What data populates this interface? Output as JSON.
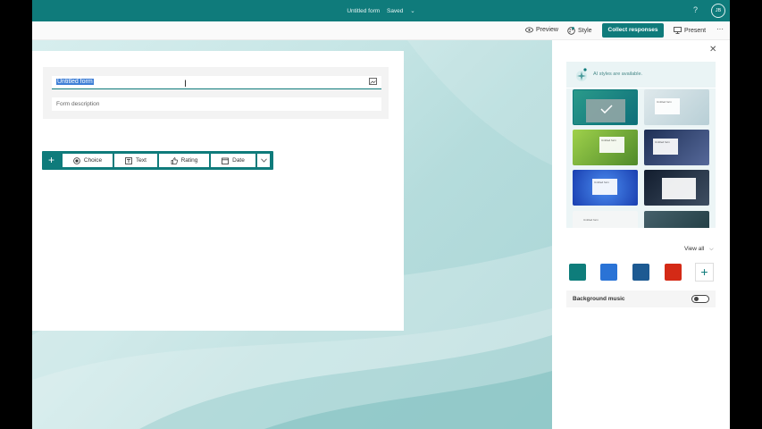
{
  "topbar": {
    "form_title": "Untitled form",
    "status": "Saved",
    "status_more": "⌄",
    "help": "?",
    "avatar_initials": "JB"
  },
  "toolbar": {
    "preview": "Preview",
    "style": "Style",
    "collect": "Collect responses",
    "present": "Present",
    "more": "···"
  },
  "form": {
    "title_value": "Untitled form",
    "description_placeholder": "Form description"
  },
  "question_types": {
    "add": "+",
    "choice": "Choice",
    "text": "Text",
    "rating": "Rating",
    "date": "Date"
  },
  "panel": {
    "close": "✕",
    "ai_text": "AI styles are available.",
    "view_all": "View all",
    "background_music": "Background music",
    "background_music_on": false,
    "theme_form_label": "Untitled form"
  },
  "colors": {
    "brand": "#0f7b7b",
    "swatches": [
      "#0e7d7b",
      "#2a73d6",
      "#1d5a92",
      "#d42a16"
    ]
  }
}
